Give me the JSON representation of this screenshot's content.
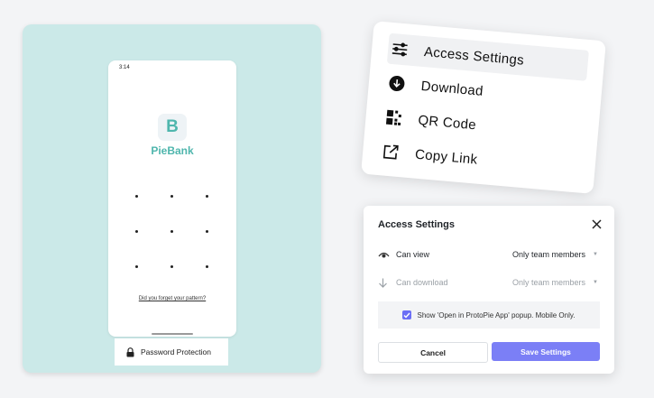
{
  "phone": {
    "time": "3:14",
    "app_logo_letter": "B",
    "app_name": "PieBank",
    "forgot_link": "Did you forget your pattern?",
    "password_tab_label": "Password Protection"
  },
  "share_menu": {
    "items": [
      {
        "label": "Access Settings",
        "icon": "sliders-icon"
      },
      {
        "label": "Download",
        "icon": "download-circle-icon"
      },
      {
        "label": "QR Code",
        "icon": "qr-code-icon"
      },
      {
        "label": "Copy Link",
        "icon": "external-link-icon"
      }
    ]
  },
  "dialog": {
    "title": "Access Settings",
    "rows": [
      {
        "label": "Can view",
        "value": "Only team members",
        "icon": "eye-icon"
      },
      {
        "label": "Can download",
        "value": "Only team members",
        "icon": "arrow-down-icon"
      }
    ],
    "popup_option": "Show 'Open in ProtoPie App' popup. Mobile Only.",
    "popup_checked": true,
    "cancel_label": "Cancel",
    "save_label": "Save Settings"
  },
  "colors": {
    "teal_bg": "#cbe9e8",
    "brand_teal": "#4fb6ad",
    "primary_button": "#7b7ff6"
  }
}
